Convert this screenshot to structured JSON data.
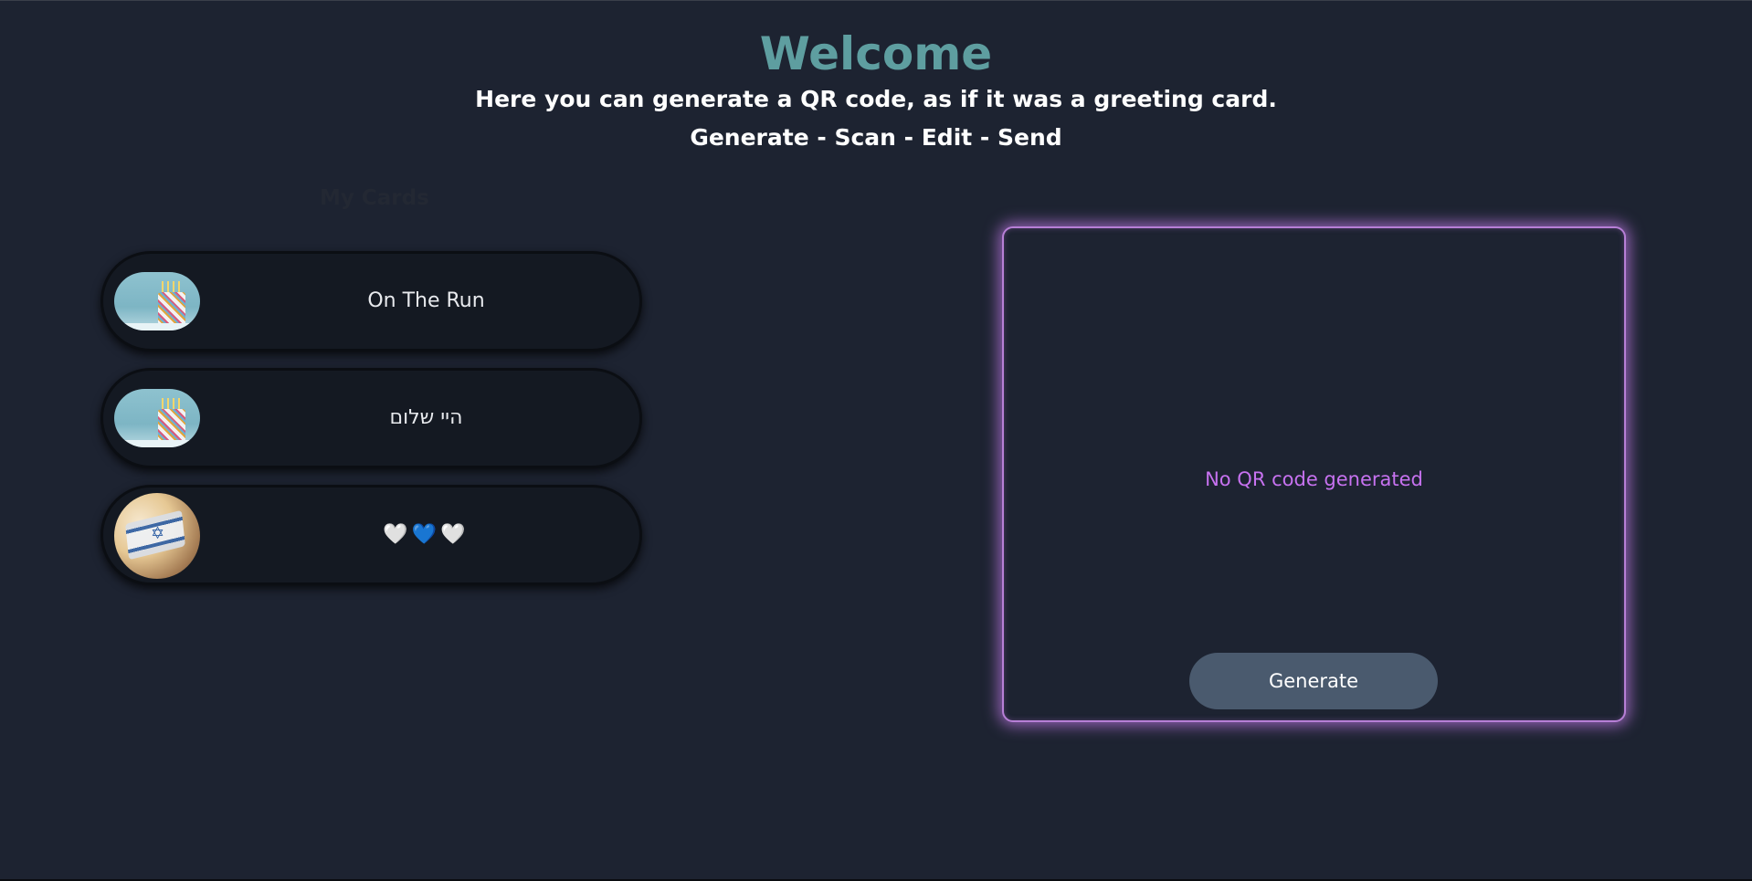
{
  "header": {
    "title": "Welcome",
    "subtitle": "Here you can generate a QR code, as if it was a greeting card.",
    "steps": "Generate - Scan - Edit - Send"
  },
  "card_list": {
    "label": "My Cards",
    "cards": [
      {
        "label": "On The Run",
        "image": "birthday-cake-image"
      },
      {
        "label": "היי שלום",
        "image": "birthday-cake-image"
      },
      {
        "label": "🤍💙🤍",
        "image": "israel-flag-image"
      }
    ]
  },
  "qr_panel": {
    "status": "No QR code generated",
    "generate_label": "Generate",
    "glow_color": "#b77fd6",
    "status_color": "#c772f0"
  },
  "colors": {
    "background": "#1d2331",
    "title": "#5e9ea0",
    "button": "#4a5a6e"
  }
}
